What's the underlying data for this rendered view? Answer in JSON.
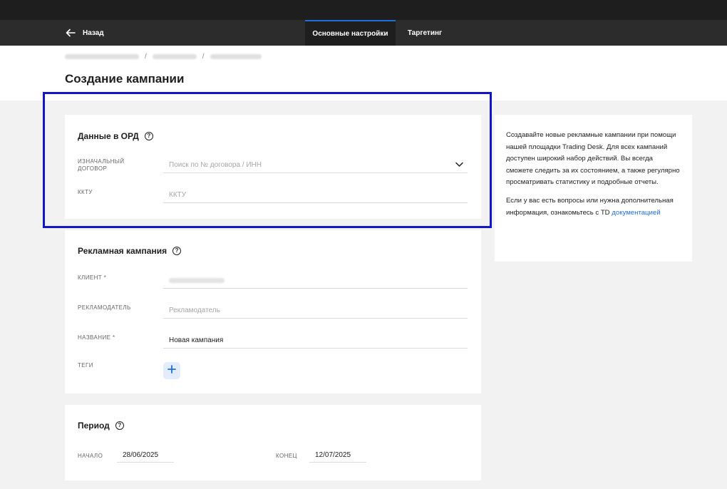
{
  "nav": {
    "back_label": "Назад",
    "tabs": [
      {
        "label": "Основные настройки",
        "active": true
      },
      {
        "label": "Таргетинг",
        "active": false
      }
    ]
  },
  "breadcrumb": {
    "separator": "/"
  },
  "page_title": "Создание кампании",
  "ord": {
    "title": "Данные в ОРД",
    "contract_label": "ИЗНАЧАЛЬНЫЙ ДОГОВОР",
    "contract_placeholder": "Поиск по № договора / ИНН",
    "kktu_label": "ККТУ",
    "kktu_placeholder": "ККТУ"
  },
  "campaign": {
    "title": "Рекламная кампания",
    "client_label": "КЛИЕНТ *",
    "advertiser_label": "РЕКЛАМОДАТЕЛЬ",
    "advertiser_placeholder": "Рекламодатель",
    "name_label": "НАЗВАНИЕ *",
    "name_value": "Новая кампания",
    "tags_label": "ТЕГИ"
  },
  "period": {
    "title": "Период",
    "start_label": "НАЧАЛО",
    "start_value": "28/06/2025",
    "end_label": "КОНЕЦ",
    "end_value": "12/07/2025"
  },
  "info": {
    "paragraph1": "Создавайте новые рекламные кампании при помощи нашей площадки Trading Desk. Для всех кампаний доступен широкий набор действий. Вы всегда сможете следить за их состоянием, а также регулярно просматривать статистику и подробные отчеты.",
    "paragraph2_prefix": "Если у вас есть вопросы или нужна дополнительная информация, ознакомьтесь с TD ",
    "docs_link": "документацией"
  },
  "colors": {
    "accent": "#1f6fd9",
    "highlight_border": "#1414c8",
    "topbar": "#1e1e1e",
    "navbar": "#2c2c2c"
  },
  "icons": {
    "back": "arrow-left-icon",
    "dropdown": "chevron-down-icon",
    "help": "help-circle-icon",
    "add_tag": "plus-icon"
  }
}
